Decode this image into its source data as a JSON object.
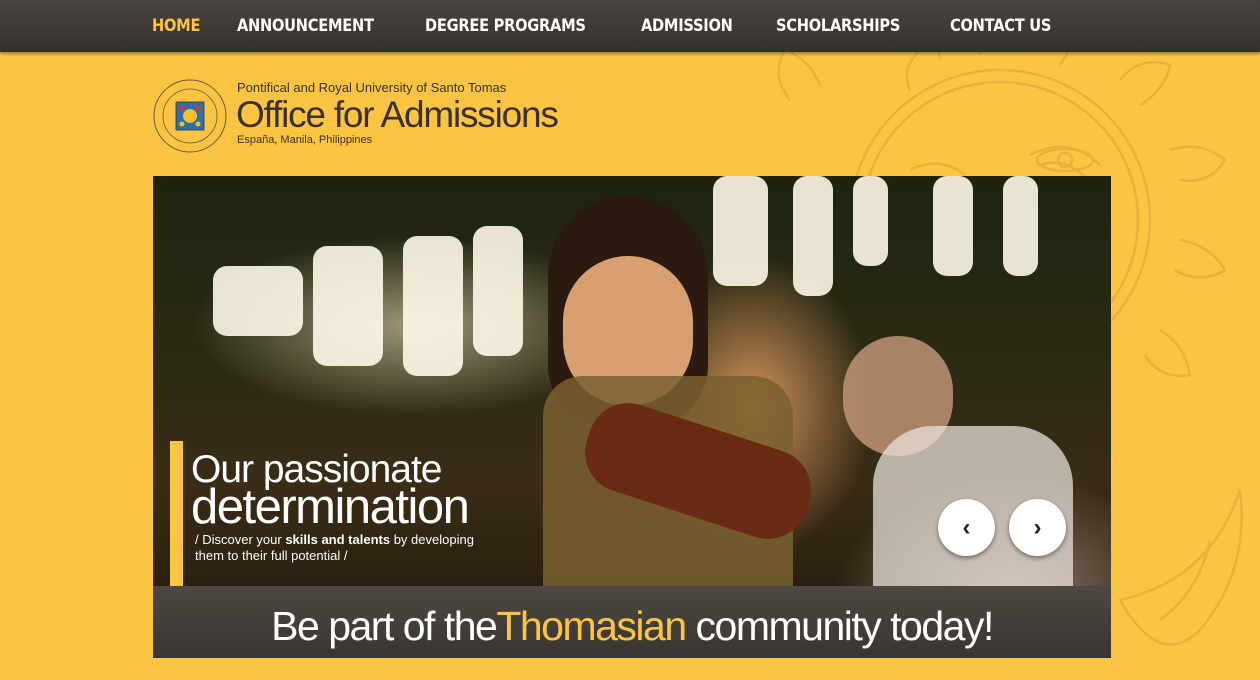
{
  "nav": {
    "items": [
      {
        "label": "HOME",
        "active": true
      },
      {
        "label": "ANNOUNCEMENT",
        "active": false
      },
      {
        "label": "DEGREE PROGRAMS",
        "active": false
      },
      {
        "label": "ADMISSION",
        "active": false
      },
      {
        "label": "SCHOLARSHIPS",
        "active": false
      },
      {
        "label": "CONTACT US",
        "active": false
      }
    ]
  },
  "header": {
    "university_name": "Pontifical and Royal University of Santo Tomas",
    "office_title": "Office for Admissions",
    "location": "España, Manila, Philippines"
  },
  "hero": {
    "heading_line1": "Our passionate",
    "heading_line2": "determination",
    "sub_prefix": "/ Discover your ",
    "sub_bold": "skills and talents",
    "sub_suffix": " by developing them to their full potential /",
    "prev_icon": "chevron-left-icon",
    "next_icon": "chevron-right-icon"
  },
  "cta": {
    "text_before": "Be part of the",
    "text_accent": "Thomasian",
    "text_after": " community today!"
  },
  "colors": {
    "accent": "#fcc443",
    "nav_bg": "#3d3834",
    "text_dark": "#3b3026"
  }
}
